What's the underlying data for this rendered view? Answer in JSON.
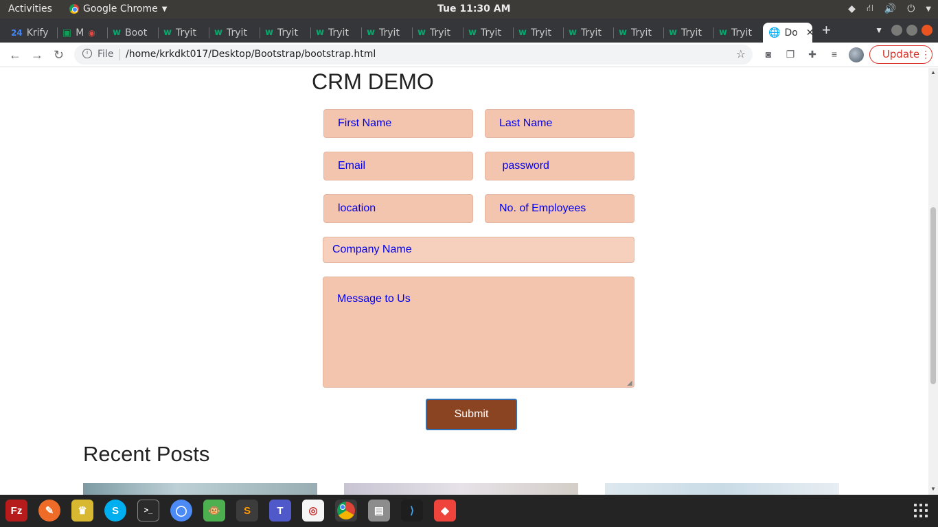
{
  "system_bar": {
    "activities": "Activities",
    "app_name": "Google Chrome",
    "clock": "Tue 11:30 AM"
  },
  "tabs": [
    {
      "label": "Krify",
      "icon": "calendar-icon"
    },
    {
      "label": "M",
      "icon": "meet-icon"
    },
    {
      "label": "Boot",
      "icon": "w3schools-icon"
    },
    {
      "label": "Tryit",
      "icon": "w3schools-icon"
    },
    {
      "label": "Tryit",
      "icon": "w3schools-icon"
    },
    {
      "label": "Tryit",
      "icon": "w3schools-icon"
    },
    {
      "label": "Tryit",
      "icon": "w3schools-icon"
    },
    {
      "label": "Tryit",
      "icon": "w3schools-icon"
    },
    {
      "label": "Tryit",
      "icon": "w3schools-icon"
    },
    {
      "label": "Tryit",
      "icon": "w3schools-icon"
    },
    {
      "label": "Tryit",
      "icon": "w3schools-icon"
    },
    {
      "label": "Tryit",
      "icon": "w3schools-icon"
    },
    {
      "label": "Tryit",
      "icon": "w3schools-icon"
    },
    {
      "label": "Tryit",
      "icon": "w3schools-icon"
    },
    {
      "label": "Tryit",
      "icon": "w3schools-icon"
    },
    {
      "label": "Do",
      "icon": "globe-icon",
      "active": true
    }
  ],
  "toolbar": {
    "file_label": "File",
    "url": "/home/krkdkt017/Desktop/Bootstrap/bootstrap.html",
    "update_label": "Update"
  },
  "page": {
    "title": "CRM DEMO",
    "fields": {
      "first_name": "First Name",
      "last_name": "Last Name",
      "email": "Email",
      "password": " password",
      "location": "location",
      "employees": "No. of Employees",
      "company": "Company Name",
      "message": "Message to Us"
    },
    "submit_label": "Submit",
    "recent_posts_title": "Recent Posts"
  },
  "colors": {
    "field_bg": "#f4c5ae",
    "field_text": "#0000ee",
    "submit_bg": "#8b4422",
    "update_red": "#d93025"
  },
  "dock": [
    {
      "name": "FileZilla",
      "icon": "filezilla-icon"
    },
    {
      "name": "Postman",
      "icon": "postman-icon"
    },
    {
      "name": "Pencil",
      "icon": "pencil-icon"
    },
    {
      "name": "Skype",
      "icon": "skype-icon"
    },
    {
      "name": "Terminal",
      "icon": "terminal-icon"
    },
    {
      "name": "Chromium",
      "icon": "chromium-icon"
    },
    {
      "name": "Monkey",
      "icon": "monkey-icon"
    },
    {
      "name": "Sublime Text",
      "icon": "sublime-icon"
    },
    {
      "name": "Teams",
      "icon": "teams-icon"
    },
    {
      "name": "Document Viewer",
      "icon": "document-viewer-icon"
    },
    {
      "name": "Google Chrome",
      "icon": "chrome-icon"
    },
    {
      "name": "Files",
      "icon": "files-icon"
    },
    {
      "name": "VS Code",
      "icon": "vscode-icon"
    },
    {
      "name": "AnyDesk",
      "icon": "anydesk-icon"
    }
  ]
}
